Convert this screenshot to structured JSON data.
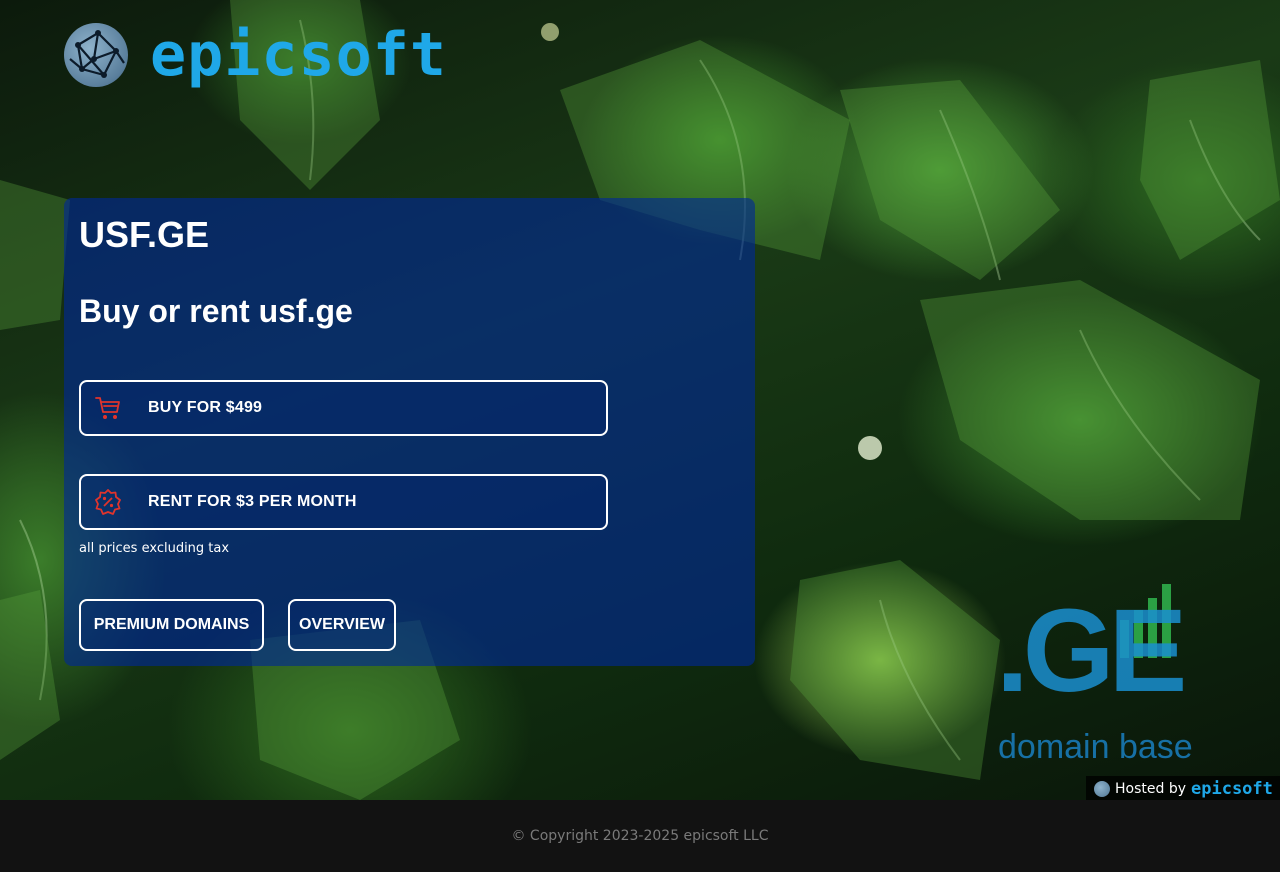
{
  "header": {
    "brand": "epicsoft"
  },
  "card": {
    "domain_title": "USF.GE",
    "subtitle": "Buy or rent usf.ge",
    "buy_label": "BUY FOR $499",
    "rent_label": "RENT FOR $3 PER MONTH",
    "tax_note": "all prices excluding tax",
    "premium_label": "PREMIUM DOMAINS",
    "overview_label": "OVERVIEW"
  },
  "ge_logo": {
    "main": ".GE",
    "sub": "domain base"
  },
  "hosted_badge": {
    "label": "Hosted by",
    "brand": "epicsoft"
  },
  "footer": {
    "copyright": "© Copyright 2023-2025 epicsoft LLC"
  },
  "icons": {
    "cart": "cart-icon",
    "rent": "discount-badge-icon",
    "globe": "network-globe-icon"
  },
  "colors": {
    "brand_blue": "#1fa8e8",
    "card_bg": "#00289a",
    "icon_red": "#e0342c",
    "footer_bg": "#121212"
  }
}
